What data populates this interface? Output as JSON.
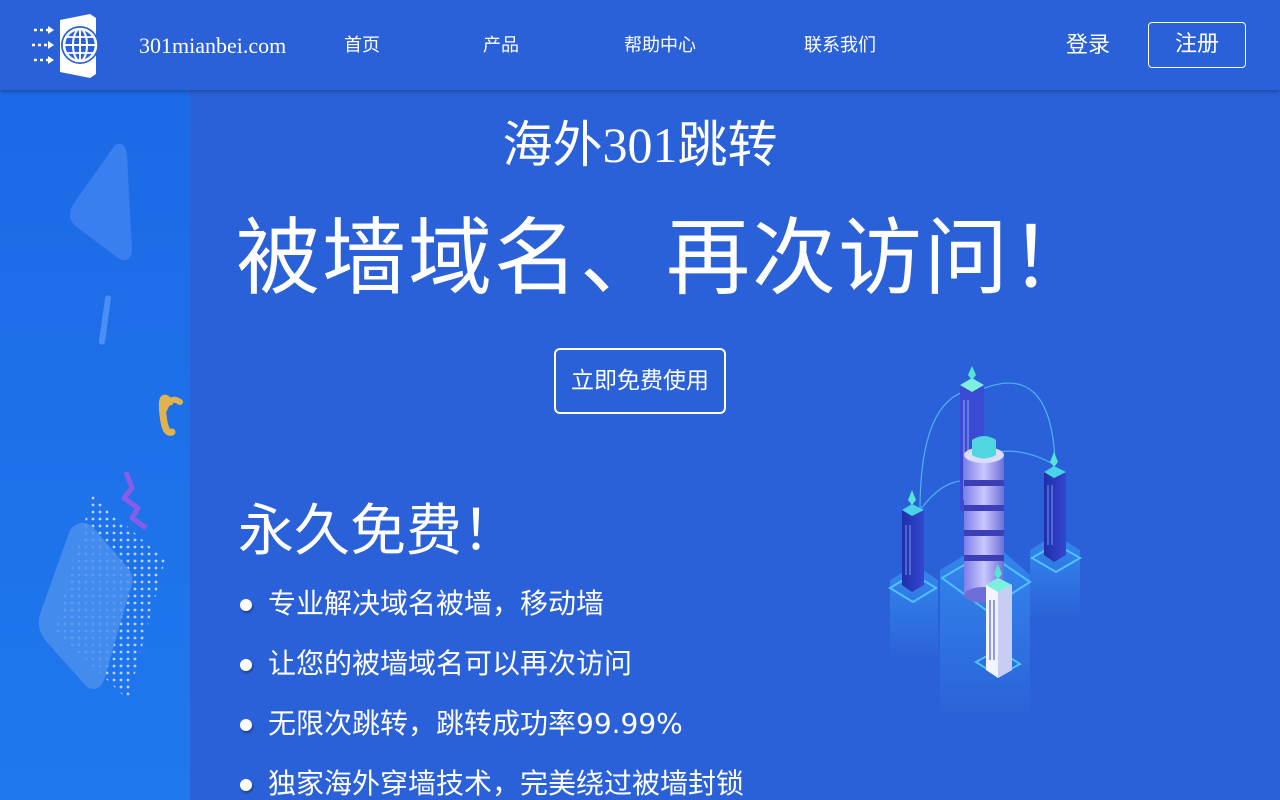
{
  "header": {
    "site_name": "301mianbei.com",
    "nav": [
      {
        "label": "首页"
      },
      {
        "label": "产品"
      },
      {
        "label": "帮助中心"
      },
      {
        "label": "联系我们"
      }
    ],
    "login_label": "登录",
    "register_label": "注册"
  },
  "hero": {
    "subtitle_prefix": "海外",
    "subtitle_number": "301",
    "subtitle_suffix": "跳转",
    "title": "被墙域名、再次访问！",
    "cta_label": "立即免费使用"
  },
  "features": {
    "title": "永久免费！",
    "items": [
      {
        "text": "专业解决域名被墙，移动墙"
      },
      {
        "text": "让您的被墙域名可以再次访问"
      },
      {
        "text": "无限次跳转，跳转成功率99.99%"
      },
      {
        "text": "独家海外穿墙技术，完美绕过被墙封锁"
      }
    ]
  },
  "icons": {
    "logo": "globe-door-logo-icon",
    "bullet": "bullet-dot-icon",
    "illustration": "server-towers-illustration"
  },
  "colors": {
    "background": "#2b61d8",
    "left_strip": "#1e72ea",
    "text": "#ffffff"
  }
}
